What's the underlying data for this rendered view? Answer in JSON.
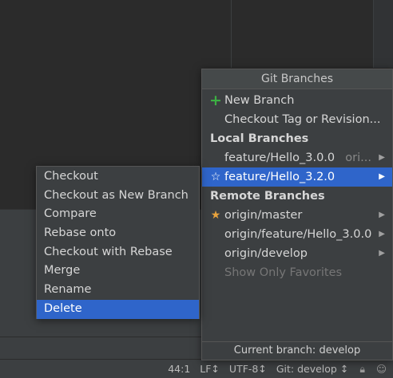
{
  "popup": {
    "title": "Git Branches",
    "items": [
      {
        "kind": "action",
        "icon": "plus-icon",
        "label": "New Branch"
      },
      {
        "kind": "action",
        "label": "Checkout Tag or Revision..."
      },
      {
        "kind": "header",
        "label": "Local Branches"
      },
      {
        "kind": "branch",
        "label": "feature/Hello_3.0.0",
        "hint": "ori..."
      },
      {
        "kind": "branch",
        "label": "feature/Hello_3.2.0",
        "icon": "star-outline-icon",
        "selected": true
      },
      {
        "kind": "header",
        "label": "Remote Branches"
      },
      {
        "kind": "branch",
        "label": "origin/master",
        "icon": "star-icon"
      },
      {
        "kind": "branch",
        "label": "origin/feature/Hello_3.0.0"
      },
      {
        "kind": "branch",
        "label": "origin/develop"
      },
      {
        "kind": "action",
        "label": "Show Only Favorites",
        "disabled": true
      }
    ],
    "footer": "Current branch: develop"
  },
  "submenu": {
    "items": [
      {
        "label": "Checkout"
      },
      {
        "label": "Checkout as New Branch"
      },
      {
        "label": "Compare"
      },
      {
        "label": "Rebase onto"
      },
      {
        "label": "Checkout with Rebase"
      },
      {
        "label": "Merge"
      },
      {
        "label": "Rename"
      },
      {
        "label": "Delete",
        "selected": true
      }
    ]
  },
  "status": {
    "position": "44:1",
    "line_separator": "LF↕",
    "encoding": "UTF-8↕",
    "vcs": "Git: develop ↕",
    "lock_icon": "lock-icon",
    "inspector_icon": "hector-icon"
  },
  "colors": {
    "accent": "#2f65ca",
    "plus": "#3cb043",
    "star": "#e8a33d"
  }
}
